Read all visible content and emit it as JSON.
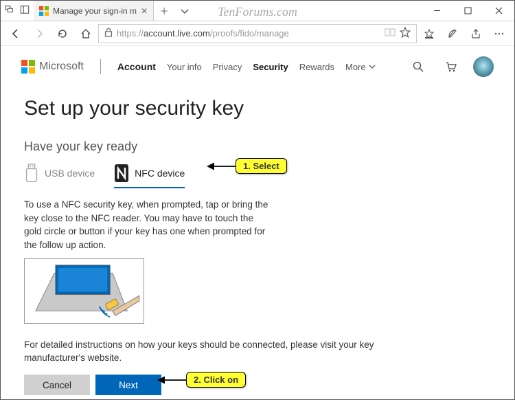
{
  "watermark": "TenForums.com",
  "browser": {
    "tab_title": "Manage your sign-in m",
    "url_scheme": "https://",
    "url_host": "account.live.com",
    "url_path": "/proofs/fido/manage"
  },
  "window": {
    "min": "—",
    "max": "☐",
    "close": "✕"
  },
  "header": {
    "brand": "Microsoft",
    "account": "Account",
    "nav": {
      "your_info": "Your info",
      "privacy": "Privacy",
      "security": "Security",
      "rewards": "Rewards",
      "more": "More"
    }
  },
  "page": {
    "title": "Set up your security key",
    "subtitle": "Have your key ready",
    "tabs": {
      "usb": "USB device",
      "nfc": "NFC device"
    },
    "desc": "To use a NFC security key, when prompted, tap or bring the key close to the NFC reader. You may have to touch the gold circle or button if your key has one when prompted for the follow up action.",
    "detail": "For detailed instructions on how your keys should be connected, please visit your key manufacturer's website.",
    "buttons": {
      "cancel": "Cancel",
      "next": "Next"
    }
  },
  "annotations": {
    "step1": "1. Select",
    "step2": "2. Click on"
  }
}
